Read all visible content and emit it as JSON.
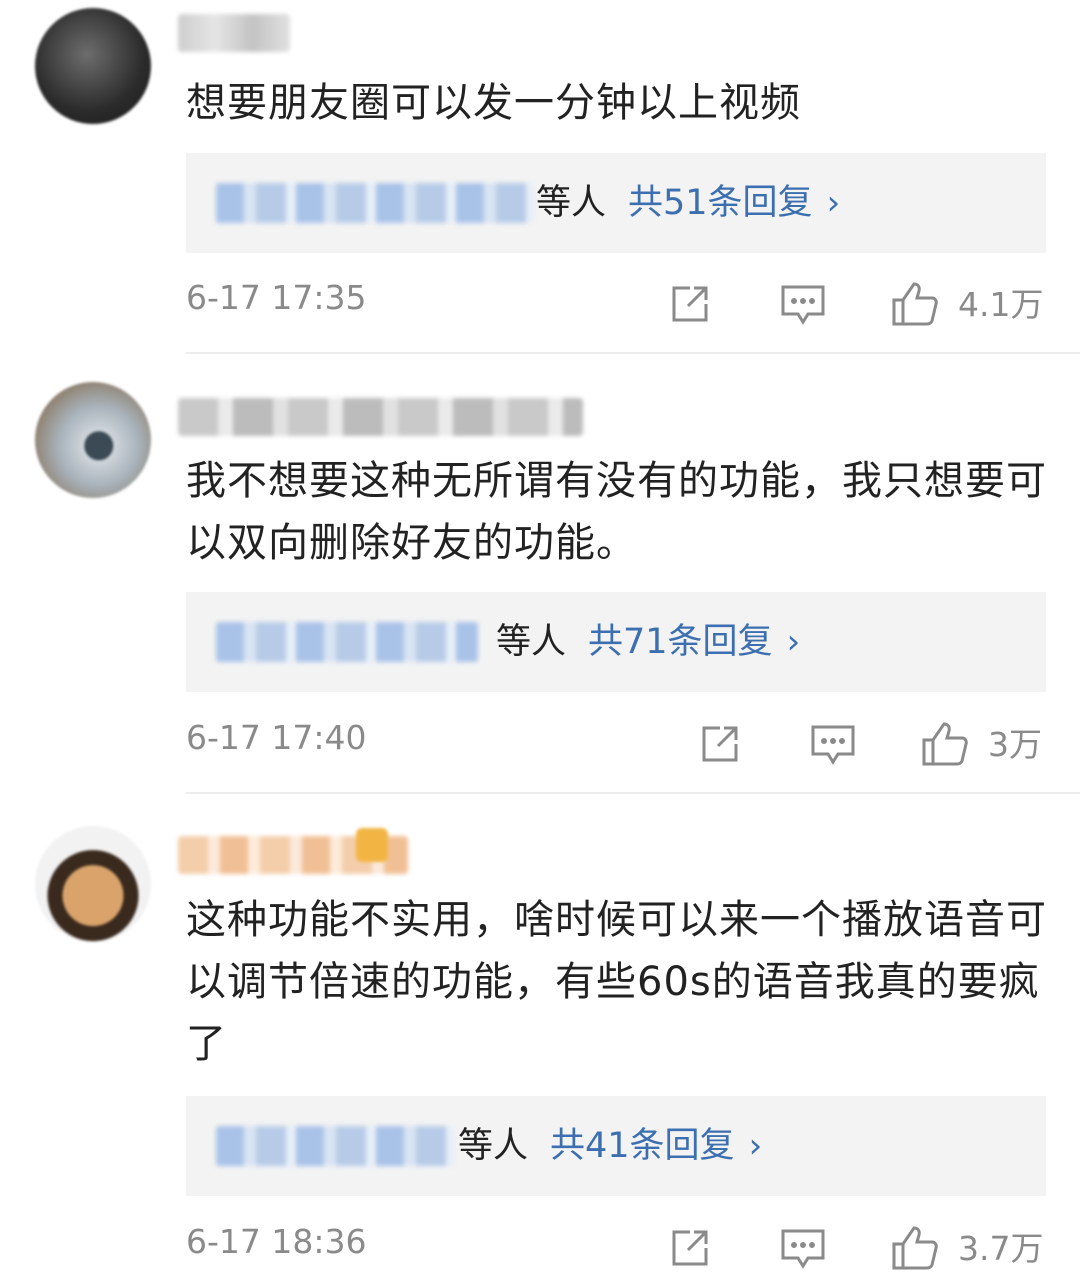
{
  "comments": [
    {
      "text": "想要朋友圈可以发一分钟以上视频",
      "reply_suffix": "等人",
      "reply_count": "共51条回复",
      "time": "6-17 17:35",
      "likes": "4.1万"
    },
    {
      "text": "我不想要这种无所谓有没有的功能，我只想要可以双向删除好友的功能。",
      "reply_suffix": "等人",
      "reply_count": "共71条回复",
      "time": "6-17 17:40",
      "likes": "3万"
    },
    {
      "text": "这种功能不实用，啥时候可以来一个播放语音可以调节倍速的功能，有些60s的语音我真的要疯了",
      "reply_suffix": "等人",
      "reply_count": "共41条回复",
      "time": "6-17 18:36",
      "likes": "3.7万"
    }
  ],
  "reply_arrow": "›",
  "icons": {
    "share": "share-icon",
    "comment": "comment-icon",
    "like": "thumbs-up-icon"
  }
}
